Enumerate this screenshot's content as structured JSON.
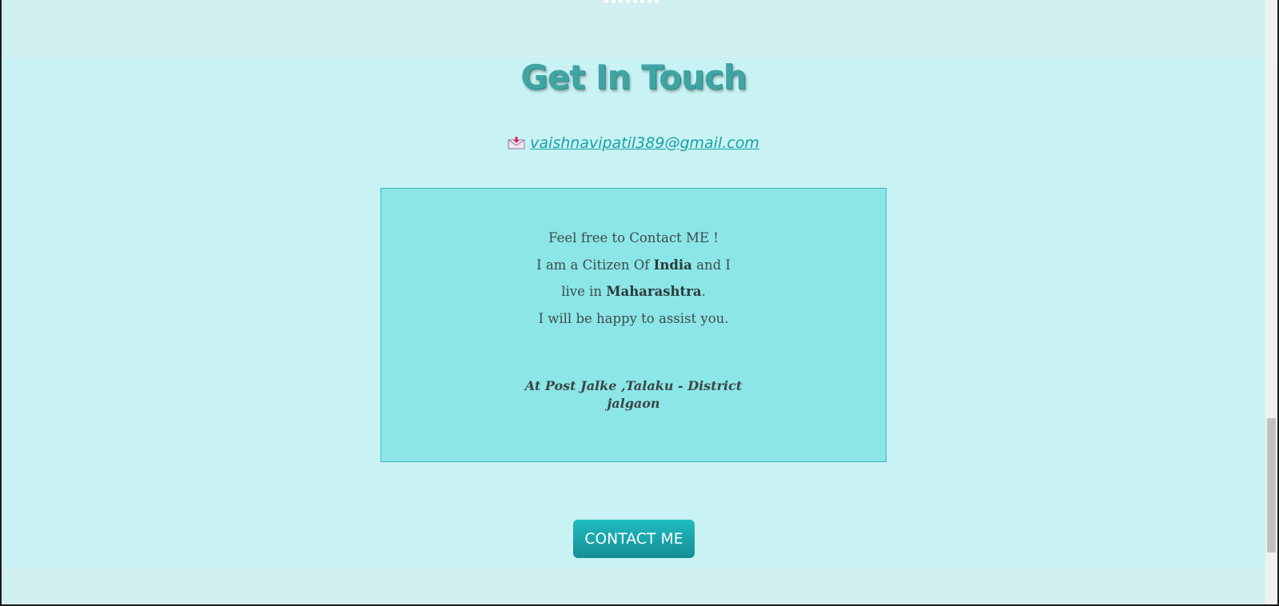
{
  "contact": {
    "title": "Get In Touch",
    "email": "vaishnavipatil389@gmail.com",
    "email_icon": "envelope-download-icon",
    "card": {
      "line1": "Feel free to Contact ME !",
      "line2_pre": "I am a Citizen Of ",
      "line2_bold": "India",
      "line2_post": " and I",
      "line3_pre": "live in ",
      "line3_bold": "Maharashtra",
      "line3_post": ".",
      "line4": "I will be happy to assist you.",
      "address_line1": "At Post Jalke ,Talaku - District",
      "address_line2": "jalgaon"
    },
    "button_label": "CONTACT ME"
  },
  "colors": {
    "page_bg": "#d2eff1",
    "section_bg": "#c8f2f3",
    "card_bg": "#8ce6e7",
    "accent": "#17a2a5",
    "title": "#3fa5a3"
  }
}
